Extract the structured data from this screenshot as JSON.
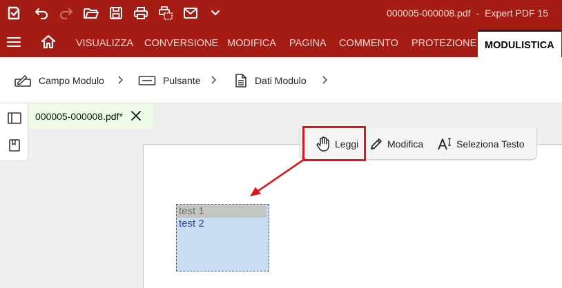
{
  "window": {
    "file_name": "000005-000008.pdf",
    "separator": "-",
    "app_name": "Expert PDF 15"
  },
  "quick_access": {
    "icons": [
      "app-logo-icon",
      "undo-icon",
      "redo-icon",
      "open-folder-icon",
      "save-icon",
      "print-icon",
      "print-range-icon",
      "email-icon",
      "customize-chevron-icon"
    ]
  },
  "ribbon_tabs": [
    {
      "label": "VISUALIZZA"
    },
    {
      "label": "CONVERSIONE"
    },
    {
      "label": "MODIFICA"
    },
    {
      "label": "PAGINA"
    },
    {
      "label": "COMMENTO"
    },
    {
      "label": "PROTEZIONE"
    },
    {
      "label": "MODULISTICA",
      "active": true
    }
  ],
  "ribbon": {
    "items": [
      {
        "label": "Campo Modulo",
        "icon": "form-field-icon"
      },
      {
        "label": "Pulsante",
        "icon": "button-icon"
      },
      {
        "label": "Dati Modulo",
        "icon": "form-data-icon"
      }
    ]
  },
  "document_tab": {
    "label": "000005-000008.pdf*"
  },
  "float_toolbar": {
    "read": "Leggi",
    "edit": "Modifica",
    "select_text": "Seleziona Testo"
  },
  "listbox": {
    "items": [
      "test 1",
      "test 2"
    ],
    "selected_index": 0
  },
  "colors": {
    "brand": "#a51c14",
    "annotation": "#e0141a",
    "field_fill": "#c8dcf2"
  }
}
